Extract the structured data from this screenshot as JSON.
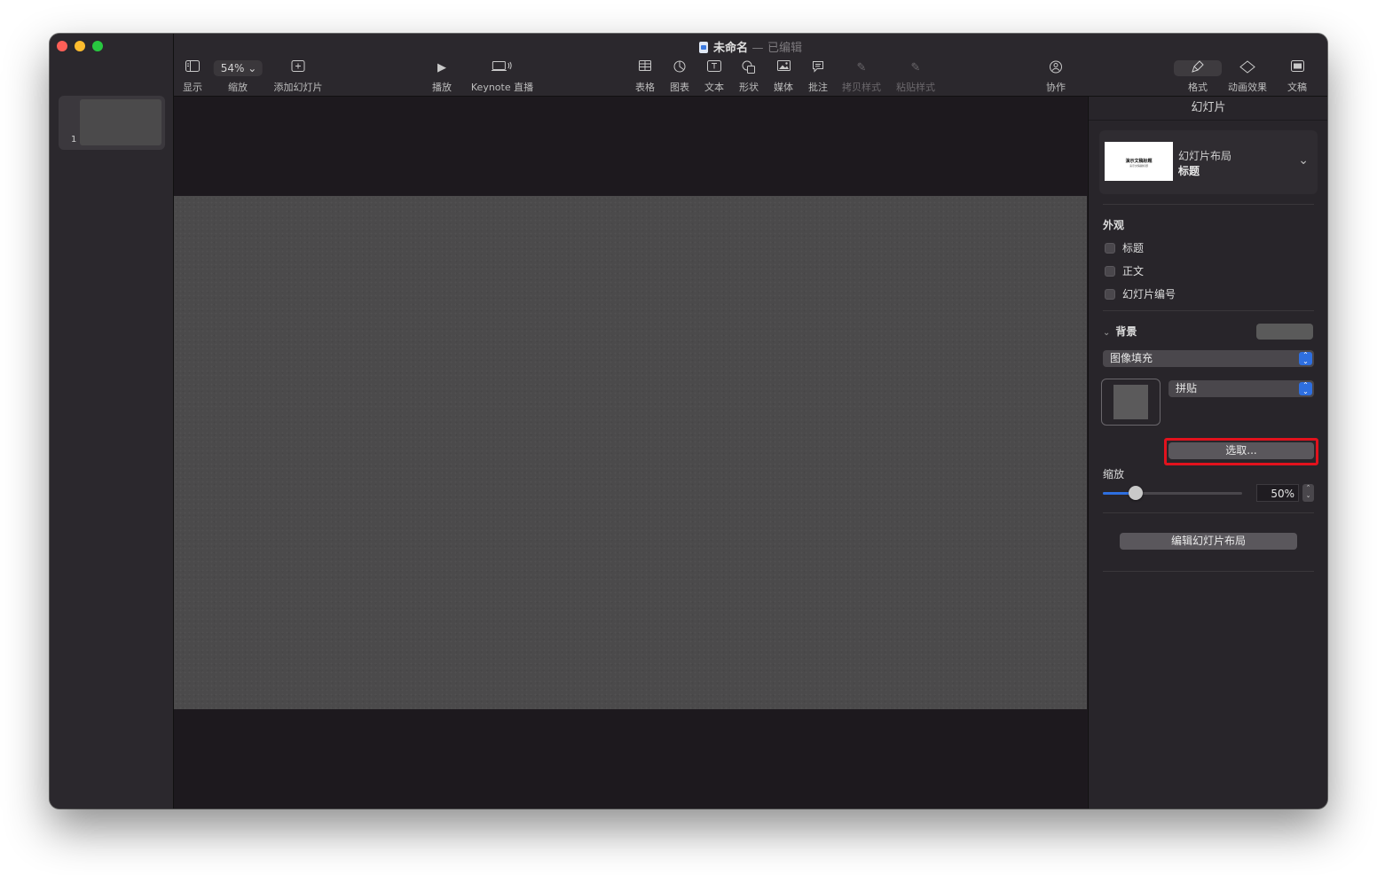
{
  "window": {
    "title": "未命名",
    "title_separator": "—",
    "status": "已编辑"
  },
  "toolbar": {
    "view_label": "显示",
    "zoom_value": "54%",
    "zoom_label": "缩放",
    "add_slide_label": "添加幻灯片",
    "play_label": "播放",
    "keynote_live_label": "Keynote 直播",
    "table_label": "表格",
    "chart_label": "图表",
    "text_label": "文本",
    "shape_label": "形状",
    "media_label": "媒体",
    "comment_label": "批注",
    "copy_style_label": "拷贝样式",
    "paste_style_label": "粘贴样式",
    "collaborate_label": "协作",
    "format_label": "格式",
    "animate_label": "动画效果",
    "document_label": "文稿"
  },
  "navigator": {
    "slides": [
      {
        "number": "1"
      }
    ]
  },
  "inspector": {
    "header": "幻灯片",
    "layout": {
      "label": "幻灯片布局",
      "name": "标题",
      "thumb_title": "演示文稿标题",
      "thumb_subtitle": "演示文稿副标题"
    },
    "appearance": {
      "label": "外观",
      "options": [
        {
          "label": "标题",
          "checked": false
        },
        {
          "label": "正文",
          "checked": false
        },
        {
          "label": "幻灯片编号",
          "checked": false
        }
      ]
    },
    "background": {
      "label": "背景",
      "fill_type": "图像填充",
      "image_mode": "拼贴",
      "choose_label": "选取...",
      "scale_label": "缩放",
      "scale_value": "50%",
      "scale_fraction": 0.5
    },
    "edit_layout_label": "编辑幻灯片布局"
  },
  "colors": {
    "accent": "#2e6fe0",
    "highlight": "#e2121d",
    "slide_background": "#4b4a4b"
  }
}
